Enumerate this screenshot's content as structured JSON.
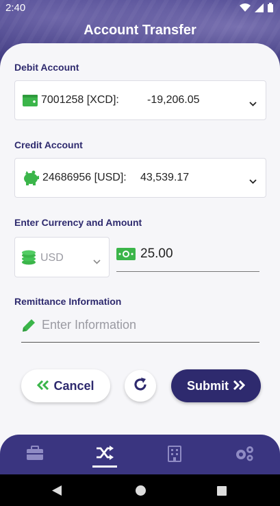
{
  "status_bar": {
    "time": "2:40"
  },
  "header": {
    "title": "Account Transfer"
  },
  "debit": {
    "label": "Debit Account",
    "account": "7001258 [XCD]:",
    "balance": "-19,206.05",
    "icon": "wallet-icon"
  },
  "credit": {
    "label": "Credit Account",
    "account": "24686956 [USD]:",
    "balance": "43,539.17",
    "icon": "piggy-bank-icon"
  },
  "amount_section": {
    "label": "Enter Currency and Amount",
    "currency": "USD",
    "amount": "25.00"
  },
  "remittance": {
    "label": "Remittance Information",
    "placeholder": "Enter Information"
  },
  "actions": {
    "cancel_label": "Cancel",
    "submit_label": "Submit"
  },
  "nav": {
    "items": [
      "briefcase-icon",
      "shuffle-icon",
      "building-icon",
      "settings-icon"
    ],
    "active_index": 1
  },
  "colors": {
    "primary": "#2e2a6e",
    "accent_green": "#3bb54a",
    "nav_bg": "#3a3580"
  }
}
